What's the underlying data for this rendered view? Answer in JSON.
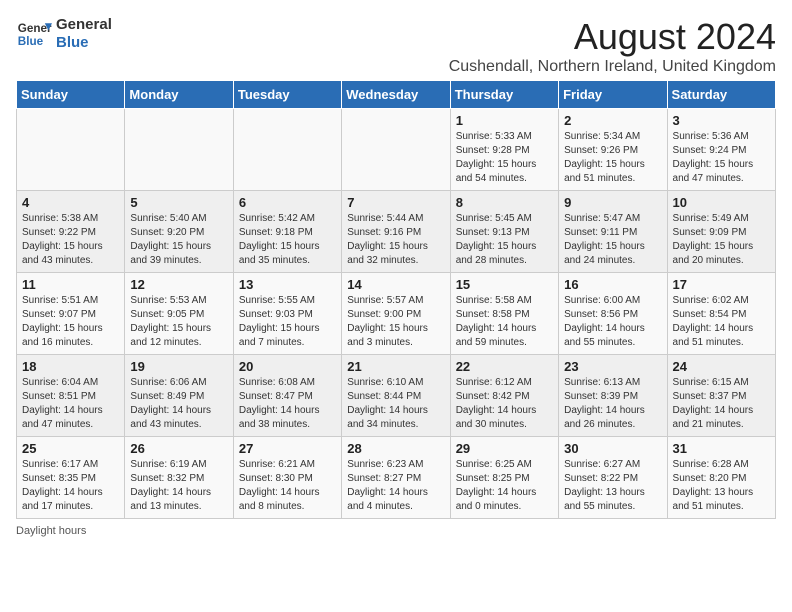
{
  "header": {
    "logo_general": "General",
    "logo_blue": "Blue",
    "main_title": "August 2024",
    "subtitle": "Cushendall, Northern Ireland, United Kingdom"
  },
  "weekdays": [
    "Sunday",
    "Monday",
    "Tuesday",
    "Wednesday",
    "Thursday",
    "Friday",
    "Saturday"
  ],
  "weeks": [
    [
      {
        "day": "",
        "info": ""
      },
      {
        "day": "",
        "info": ""
      },
      {
        "day": "",
        "info": ""
      },
      {
        "day": "",
        "info": ""
      },
      {
        "day": "1",
        "info": "Sunrise: 5:33 AM\nSunset: 9:28 PM\nDaylight: 15 hours and 54 minutes."
      },
      {
        "day": "2",
        "info": "Sunrise: 5:34 AM\nSunset: 9:26 PM\nDaylight: 15 hours and 51 minutes."
      },
      {
        "day": "3",
        "info": "Sunrise: 5:36 AM\nSunset: 9:24 PM\nDaylight: 15 hours and 47 minutes."
      }
    ],
    [
      {
        "day": "4",
        "info": "Sunrise: 5:38 AM\nSunset: 9:22 PM\nDaylight: 15 hours and 43 minutes."
      },
      {
        "day": "5",
        "info": "Sunrise: 5:40 AM\nSunset: 9:20 PM\nDaylight: 15 hours and 39 minutes."
      },
      {
        "day": "6",
        "info": "Sunrise: 5:42 AM\nSunset: 9:18 PM\nDaylight: 15 hours and 35 minutes."
      },
      {
        "day": "7",
        "info": "Sunrise: 5:44 AM\nSunset: 9:16 PM\nDaylight: 15 hours and 32 minutes."
      },
      {
        "day": "8",
        "info": "Sunrise: 5:45 AM\nSunset: 9:13 PM\nDaylight: 15 hours and 28 minutes."
      },
      {
        "day": "9",
        "info": "Sunrise: 5:47 AM\nSunset: 9:11 PM\nDaylight: 15 hours and 24 minutes."
      },
      {
        "day": "10",
        "info": "Sunrise: 5:49 AM\nSunset: 9:09 PM\nDaylight: 15 hours and 20 minutes."
      }
    ],
    [
      {
        "day": "11",
        "info": "Sunrise: 5:51 AM\nSunset: 9:07 PM\nDaylight: 15 hours and 16 minutes."
      },
      {
        "day": "12",
        "info": "Sunrise: 5:53 AM\nSunset: 9:05 PM\nDaylight: 15 hours and 12 minutes."
      },
      {
        "day": "13",
        "info": "Sunrise: 5:55 AM\nSunset: 9:03 PM\nDaylight: 15 hours and 7 minutes."
      },
      {
        "day": "14",
        "info": "Sunrise: 5:57 AM\nSunset: 9:00 PM\nDaylight: 15 hours and 3 minutes."
      },
      {
        "day": "15",
        "info": "Sunrise: 5:58 AM\nSunset: 8:58 PM\nDaylight: 14 hours and 59 minutes."
      },
      {
        "day": "16",
        "info": "Sunrise: 6:00 AM\nSunset: 8:56 PM\nDaylight: 14 hours and 55 minutes."
      },
      {
        "day": "17",
        "info": "Sunrise: 6:02 AM\nSunset: 8:54 PM\nDaylight: 14 hours and 51 minutes."
      }
    ],
    [
      {
        "day": "18",
        "info": "Sunrise: 6:04 AM\nSunset: 8:51 PM\nDaylight: 14 hours and 47 minutes."
      },
      {
        "day": "19",
        "info": "Sunrise: 6:06 AM\nSunset: 8:49 PM\nDaylight: 14 hours and 43 minutes."
      },
      {
        "day": "20",
        "info": "Sunrise: 6:08 AM\nSunset: 8:47 PM\nDaylight: 14 hours and 38 minutes."
      },
      {
        "day": "21",
        "info": "Sunrise: 6:10 AM\nSunset: 8:44 PM\nDaylight: 14 hours and 34 minutes."
      },
      {
        "day": "22",
        "info": "Sunrise: 6:12 AM\nSunset: 8:42 PM\nDaylight: 14 hours and 30 minutes."
      },
      {
        "day": "23",
        "info": "Sunrise: 6:13 AM\nSunset: 8:39 PM\nDaylight: 14 hours and 26 minutes."
      },
      {
        "day": "24",
        "info": "Sunrise: 6:15 AM\nSunset: 8:37 PM\nDaylight: 14 hours and 21 minutes."
      }
    ],
    [
      {
        "day": "25",
        "info": "Sunrise: 6:17 AM\nSunset: 8:35 PM\nDaylight: 14 hours and 17 minutes."
      },
      {
        "day": "26",
        "info": "Sunrise: 6:19 AM\nSunset: 8:32 PM\nDaylight: 14 hours and 13 minutes."
      },
      {
        "day": "27",
        "info": "Sunrise: 6:21 AM\nSunset: 8:30 PM\nDaylight: 14 hours and 8 minutes."
      },
      {
        "day": "28",
        "info": "Sunrise: 6:23 AM\nSunset: 8:27 PM\nDaylight: 14 hours and 4 minutes."
      },
      {
        "day": "29",
        "info": "Sunrise: 6:25 AM\nSunset: 8:25 PM\nDaylight: 14 hours and 0 minutes."
      },
      {
        "day": "30",
        "info": "Sunrise: 6:27 AM\nSunset: 8:22 PM\nDaylight: 13 hours and 55 minutes."
      },
      {
        "day": "31",
        "info": "Sunrise: 6:28 AM\nSunset: 8:20 PM\nDaylight: 13 hours and 51 minutes."
      }
    ]
  ],
  "footer": {
    "note": "Daylight hours"
  }
}
